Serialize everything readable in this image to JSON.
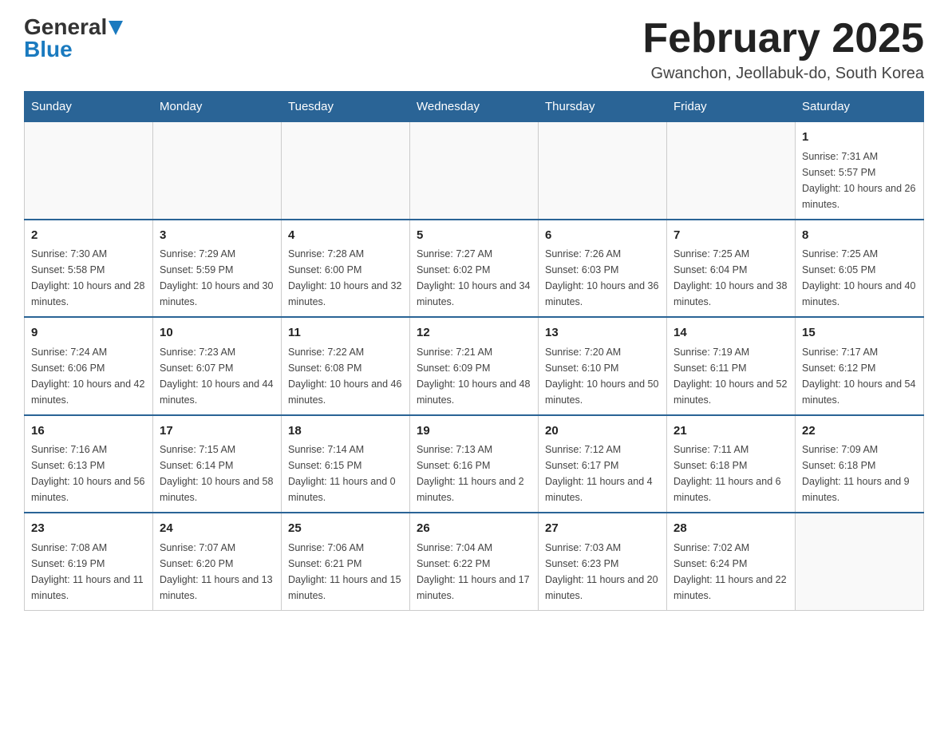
{
  "logo": {
    "general": "General",
    "blue": "Blue"
  },
  "header": {
    "title": "February 2025",
    "location": "Gwanchon, Jeollabuk-do, South Korea"
  },
  "weekdays": [
    "Sunday",
    "Monday",
    "Tuesday",
    "Wednesday",
    "Thursday",
    "Friday",
    "Saturday"
  ],
  "weeks": [
    [
      {
        "day": "",
        "sunrise": "",
        "sunset": "",
        "daylight": ""
      },
      {
        "day": "",
        "sunrise": "",
        "sunset": "",
        "daylight": ""
      },
      {
        "day": "",
        "sunrise": "",
        "sunset": "",
        "daylight": ""
      },
      {
        "day": "",
        "sunrise": "",
        "sunset": "",
        "daylight": ""
      },
      {
        "day": "",
        "sunrise": "",
        "sunset": "",
        "daylight": ""
      },
      {
        "day": "",
        "sunrise": "",
        "sunset": "",
        "daylight": ""
      },
      {
        "day": "1",
        "sunrise": "Sunrise: 7:31 AM",
        "sunset": "Sunset: 5:57 PM",
        "daylight": "Daylight: 10 hours and 26 minutes."
      }
    ],
    [
      {
        "day": "2",
        "sunrise": "Sunrise: 7:30 AM",
        "sunset": "Sunset: 5:58 PM",
        "daylight": "Daylight: 10 hours and 28 minutes."
      },
      {
        "day": "3",
        "sunrise": "Sunrise: 7:29 AM",
        "sunset": "Sunset: 5:59 PM",
        "daylight": "Daylight: 10 hours and 30 minutes."
      },
      {
        "day": "4",
        "sunrise": "Sunrise: 7:28 AM",
        "sunset": "Sunset: 6:00 PM",
        "daylight": "Daylight: 10 hours and 32 minutes."
      },
      {
        "day": "5",
        "sunrise": "Sunrise: 7:27 AM",
        "sunset": "Sunset: 6:02 PM",
        "daylight": "Daylight: 10 hours and 34 minutes."
      },
      {
        "day": "6",
        "sunrise": "Sunrise: 7:26 AM",
        "sunset": "Sunset: 6:03 PM",
        "daylight": "Daylight: 10 hours and 36 minutes."
      },
      {
        "day": "7",
        "sunrise": "Sunrise: 7:25 AM",
        "sunset": "Sunset: 6:04 PM",
        "daylight": "Daylight: 10 hours and 38 minutes."
      },
      {
        "day": "8",
        "sunrise": "Sunrise: 7:25 AM",
        "sunset": "Sunset: 6:05 PM",
        "daylight": "Daylight: 10 hours and 40 minutes."
      }
    ],
    [
      {
        "day": "9",
        "sunrise": "Sunrise: 7:24 AM",
        "sunset": "Sunset: 6:06 PM",
        "daylight": "Daylight: 10 hours and 42 minutes."
      },
      {
        "day": "10",
        "sunrise": "Sunrise: 7:23 AM",
        "sunset": "Sunset: 6:07 PM",
        "daylight": "Daylight: 10 hours and 44 minutes."
      },
      {
        "day": "11",
        "sunrise": "Sunrise: 7:22 AM",
        "sunset": "Sunset: 6:08 PM",
        "daylight": "Daylight: 10 hours and 46 minutes."
      },
      {
        "day": "12",
        "sunrise": "Sunrise: 7:21 AM",
        "sunset": "Sunset: 6:09 PM",
        "daylight": "Daylight: 10 hours and 48 minutes."
      },
      {
        "day": "13",
        "sunrise": "Sunrise: 7:20 AM",
        "sunset": "Sunset: 6:10 PM",
        "daylight": "Daylight: 10 hours and 50 minutes."
      },
      {
        "day": "14",
        "sunrise": "Sunrise: 7:19 AM",
        "sunset": "Sunset: 6:11 PM",
        "daylight": "Daylight: 10 hours and 52 minutes."
      },
      {
        "day": "15",
        "sunrise": "Sunrise: 7:17 AM",
        "sunset": "Sunset: 6:12 PM",
        "daylight": "Daylight: 10 hours and 54 minutes."
      }
    ],
    [
      {
        "day": "16",
        "sunrise": "Sunrise: 7:16 AM",
        "sunset": "Sunset: 6:13 PM",
        "daylight": "Daylight: 10 hours and 56 minutes."
      },
      {
        "day": "17",
        "sunrise": "Sunrise: 7:15 AM",
        "sunset": "Sunset: 6:14 PM",
        "daylight": "Daylight: 10 hours and 58 minutes."
      },
      {
        "day": "18",
        "sunrise": "Sunrise: 7:14 AM",
        "sunset": "Sunset: 6:15 PM",
        "daylight": "Daylight: 11 hours and 0 minutes."
      },
      {
        "day": "19",
        "sunrise": "Sunrise: 7:13 AM",
        "sunset": "Sunset: 6:16 PM",
        "daylight": "Daylight: 11 hours and 2 minutes."
      },
      {
        "day": "20",
        "sunrise": "Sunrise: 7:12 AM",
        "sunset": "Sunset: 6:17 PM",
        "daylight": "Daylight: 11 hours and 4 minutes."
      },
      {
        "day": "21",
        "sunrise": "Sunrise: 7:11 AM",
        "sunset": "Sunset: 6:18 PM",
        "daylight": "Daylight: 11 hours and 6 minutes."
      },
      {
        "day": "22",
        "sunrise": "Sunrise: 7:09 AM",
        "sunset": "Sunset: 6:18 PM",
        "daylight": "Daylight: 11 hours and 9 minutes."
      }
    ],
    [
      {
        "day": "23",
        "sunrise": "Sunrise: 7:08 AM",
        "sunset": "Sunset: 6:19 PM",
        "daylight": "Daylight: 11 hours and 11 minutes."
      },
      {
        "day": "24",
        "sunrise": "Sunrise: 7:07 AM",
        "sunset": "Sunset: 6:20 PM",
        "daylight": "Daylight: 11 hours and 13 minutes."
      },
      {
        "day": "25",
        "sunrise": "Sunrise: 7:06 AM",
        "sunset": "Sunset: 6:21 PM",
        "daylight": "Daylight: 11 hours and 15 minutes."
      },
      {
        "day": "26",
        "sunrise": "Sunrise: 7:04 AM",
        "sunset": "Sunset: 6:22 PM",
        "daylight": "Daylight: 11 hours and 17 minutes."
      },
      {
        "day": "27",
        "sunrise": "Sunrise: 7:03 AM",
        "sunset": "Sunset: 6:23 PM",
        "daylight": "Daylight: 11 hours and 20 minutes."
      },
      {
        "day": "28",
        "sunrise": "Sunrise: 7:02 AM",
        "sunset": "Sunset: 6:24 PM",
        "daylight": "Daylight: 11 hours and 22 minutes."
      },
      {
        "day": "",
        "sunrise": "",
        "sunset": "",
        "daylight": ""
      }
    ]
  ]
}
